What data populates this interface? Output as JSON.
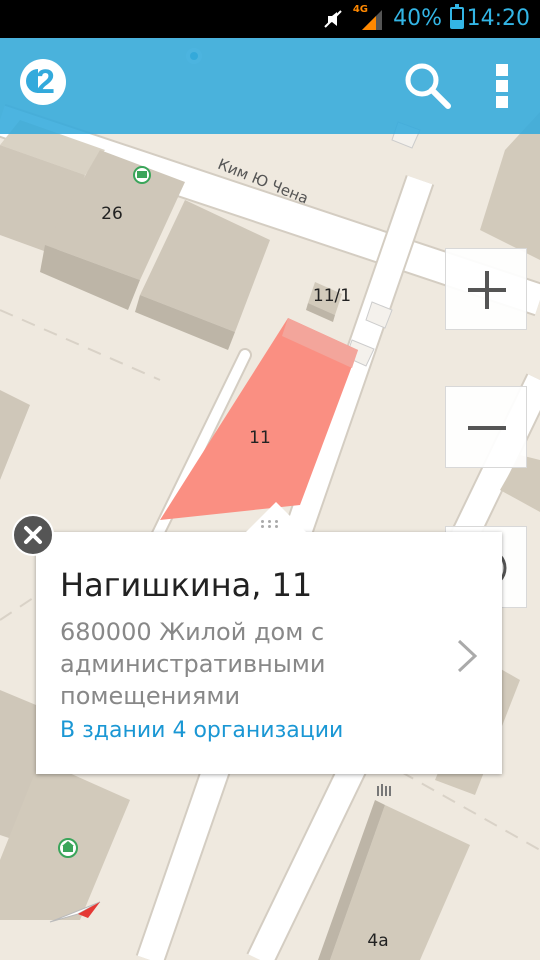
{
  "status": {
    "network": "4G",
    "battery_pct": "40%",
    "battery_level": 0.4,
    "time": "14:20"
  },
  "toolbar": {
    "logo_text": "2",
    "search_icon": "search-icon",
    "menu_icon": "overflow-menu-icon"
  },
  "map": {
    "street_name": "Ким Ю Чена",
    "labels": {
      "b26": "26",
      "b11_1": "11/1",
      "b11": "11",
      "b4a": "4а"
    },
    "colors": {
      "ground": "#efe9df",
      "building": "#d2cabb",
      "selected": "#fa8f82",
      "road": "#ffffff"
    }
  },
  "controls": {
    "zoom_in_icon": "plus-icon",
    "zoom_out_icon": "minus-icon",
    "locate_icon": "location-target-icon"
  },
  "card": {
    "title": "Нагишкина, 11",
    "address": "680000 Жилой дом с административными помещениями",
    "orgs_link": "В здании 4 организации",
    "accent": "#1a97d4"
  }
}
